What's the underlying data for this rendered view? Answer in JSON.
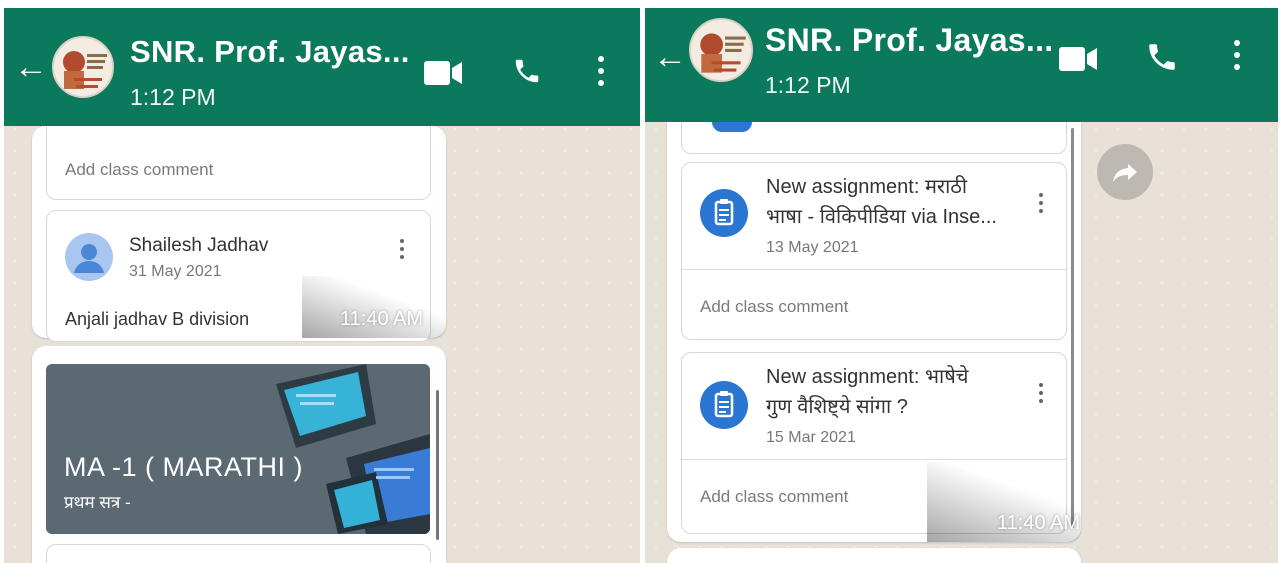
{
  "chat": {
    "contact_name": "SNR. Prof. Jayas...",
    "last_seen": "1:12 PM"
  },
  "left": {
    "add_comment_top": "Add class comment",
    "post": {
      "author": "Shailesh Jadhav",
      "date": "31 May 2021",
      "body": "Anjali jadhav B division"
    },
    "message_time": "11:40 AM",
    "class_card": {
      "title": "MA -1 ( MARATHI )",
      "subtitle": "प्रथम सत्र -"
    }
  },
  "right": {
    "assignments": [
      {
        "line1": "New assignment: मराठी",
        "line2": "भाषा - विकिपीडिया via Inse...",
        "date": "13 May 2021",
        "comment": "Add class comment"
      },
      {
        "line1": "New assignment: भाषेचे",
        "line2": "गुण वैशिष्ट्ये सांगा ?",
        "date": "15 Mar 2021",
        "comment": "Add class comment"
      }
    ],
    "message_time": "11:40 AM"
  },
  "colors": {
    "header": "#0b7a5c",
    "assignment_icon": "#2a76d2",
    "chat_background": "#e8e1d8"
  }
}
